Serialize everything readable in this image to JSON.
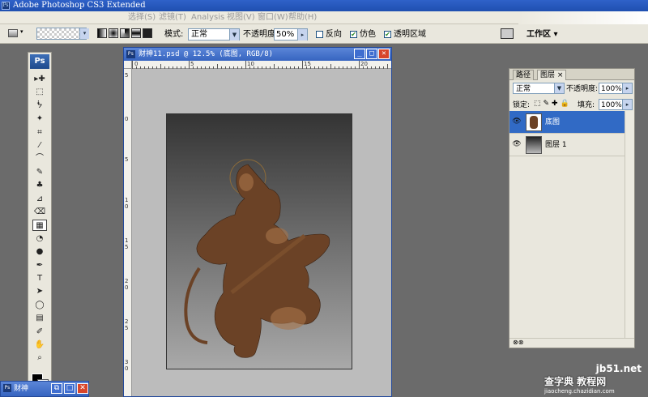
{
  "app": {
    "title": "Adobe Photoshop CS3 Extended"
  },
  "menu": [
    "选择(S)",
    "滤镜(T)",
    "Analysis",
    "视图(V)",
    "窗口(W)",
    "帮助(H)"
  ],
  "options": {
    "mode_label": "模式:",
    "mode_value": "正常",
    "opacity_label": "不透明度:",
    "opacity_value": "50%",
    "reverse_label": "反向",
    "dither_label": "仿色",
    "transparency_label": "透明区域",
    "workspace_label": "工作区 ▾",
    "reverse_checked": false,
    "dither_checked": true,
    "transparency_checked": true
  },
  "toolbox": {
    "badge": "Ps",
    "tools": [
      "▸✚",
      "⬚",
      "ᖭ",
      "✦",
      "⌗",
      "⁄",
      "⌒",
      "✎",
      "♣",
      "⊿",
      "⌫",
      "▦",
      "◔",
      "●",
      "✒",
      "T",
      "➤",
      "◯",
      "▤",
      "✐",
      "✋",
      "⌕"
    ]
  },
  "document": {
    "title": "财神11.psd @ 12.5% (底图, RGB/8)",
    "ruler_top": [
      "0",
      "5",
      "10",
      "15",
      "20"
    ],
    "ruler_left": [
      "5",
      "0",
      "5",
      "1 0",
      "1 5",
      "2 0",
      "2 5",
      "3 0"
    ]
  },
  "layers_panel": {
    "tabs": [
      "路径",
      "图层 ×"
    ],
    "blend_mode": "正常",
    "opacity_label": "不透明度:",
    "opacity_value": "100%",
    "lock_label": "锁定:",
    "fill_label": "填充:",
    "fill_value": "100%",
    "layers": [
      {
        "name": "底图",
        "selected": true
      },
      {
        "name": "图层 1",
        "selected": false
      }
    ]
  },
  "minimized_window": {
    "title": "财神"
  },
  "watermark": {
    "line1": "jb51.net",
    "line2": "查字典 教程网",
    "line3": "jiaocheng.chazidian.com"
  },
  "colors": {
    "selection": "#316ac5",
    "title_bar": "#2f62c9"
  }
}
